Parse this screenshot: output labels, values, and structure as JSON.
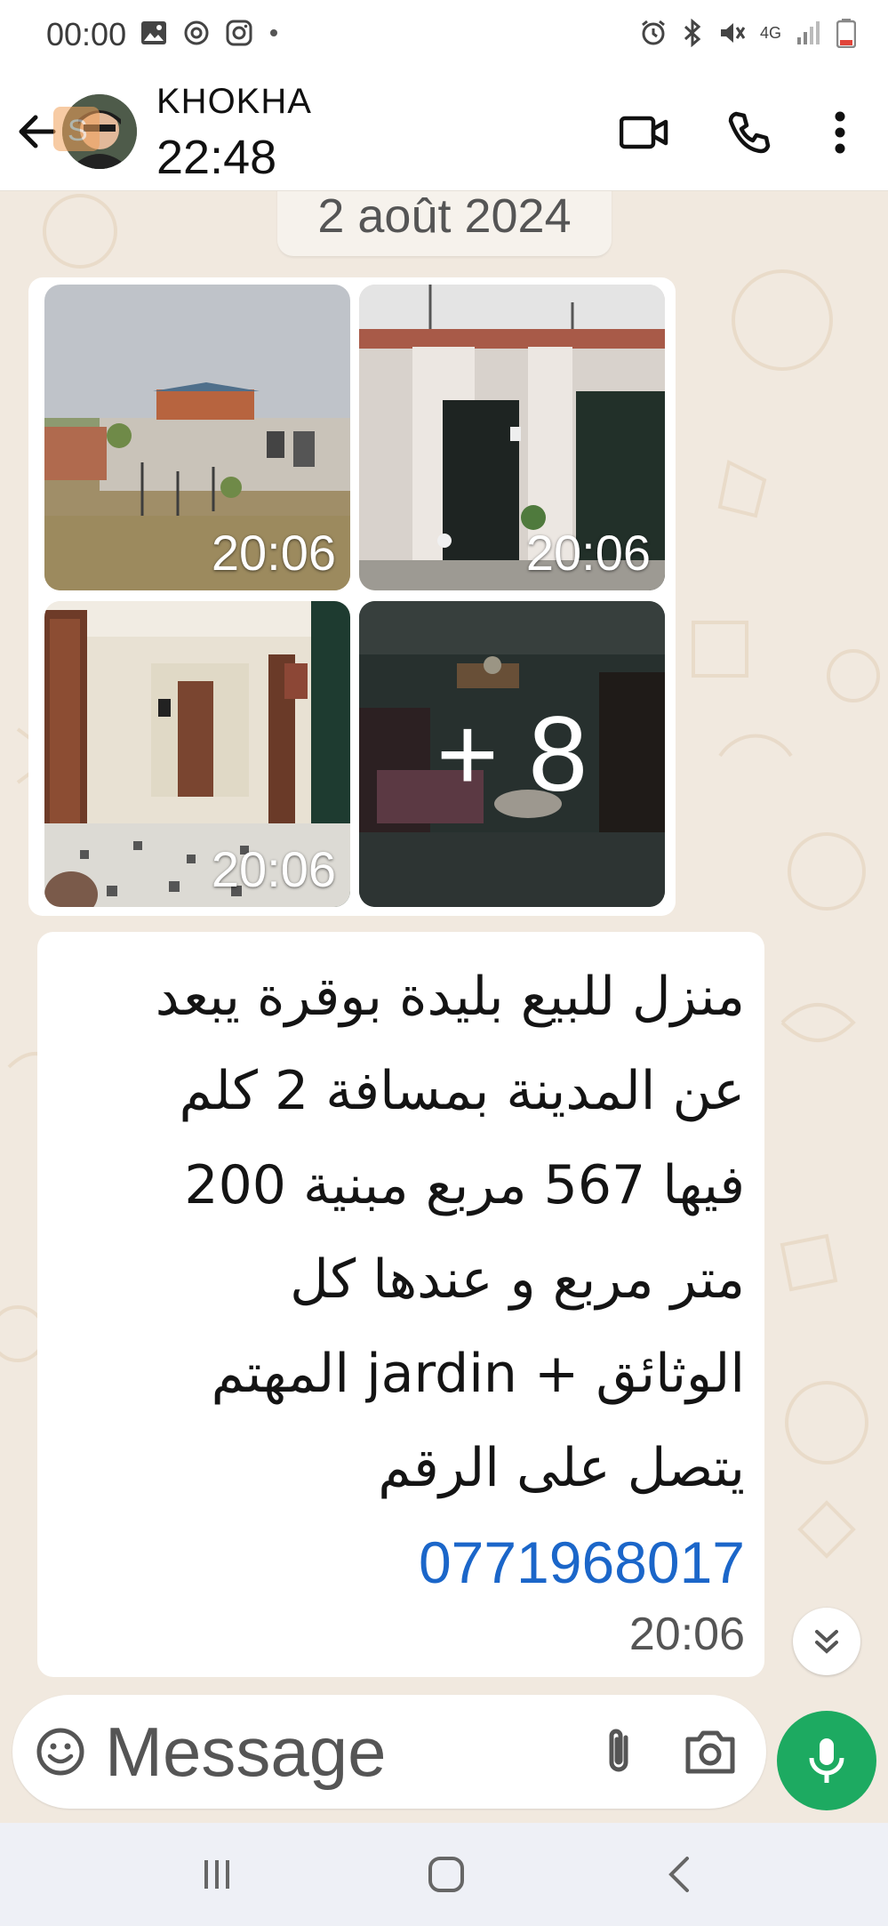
{
  "status_bar": {
    "time": "00:00",
    "left_icons": [
      "image-icon",
      "sync-icon",
      "instagram-icon",
      "dot-icon"
    ],
    "right_icons": [
      "alarm-icon",
      "bluetooth-icon",
      "mute-icon",
      "signal-icon",
      "battery-icon"
    ],
    "network": "4G"
  },
  "header": {
    "contact_name": "KHOKHA",
    "subtitle": "22:48",
    "actions": [
      "video-call-icon",
      "voice-call-icon",
      "more-options-icon"
    ]
  },
  "chat": {
    "date_divider": "2 août 2024",
    "image_message": {
      "photos": [
        {
          "time": "20:06",
          "subject": "house-exterior-field"
        },
        {
          "time": "20:06",
          "subject": "house-entrance-door"
        },
        {
          "time": "20:06",
          "subject": "hallway-interior"
        },
        {
          "time": "",
          "subject": "living-room",
          "more_count": "+ 8"
        }
      ]
    },
    "text_message": {
      "lines": [
        "منزل للبيع بليدة بوقرة يبعد",
        "عن المدينة بمسافة 2 كلم",
        "فيها 567  مربع مبنية 200",
        "متر مربع و عندها كل",
        "الوثائق + jardin  المهتم",
        "يتصل على الرقم"
      ],
      "phone": "0771968017",
      "time": "20:06"
    }
  },
  "composer": {
    "placeholder": "Message"
  },
  "nav": {
    "buttons": [
      "recents-icon",
      "home-icon",
      "back-nav-icon"
    ]
  },
  "colors": {
    "accent": "#1daa61",
    "link": "#1b66c9",
    "bubble": "#ffffff",
    "wallpaper": "#f1e9df"
  }
}
